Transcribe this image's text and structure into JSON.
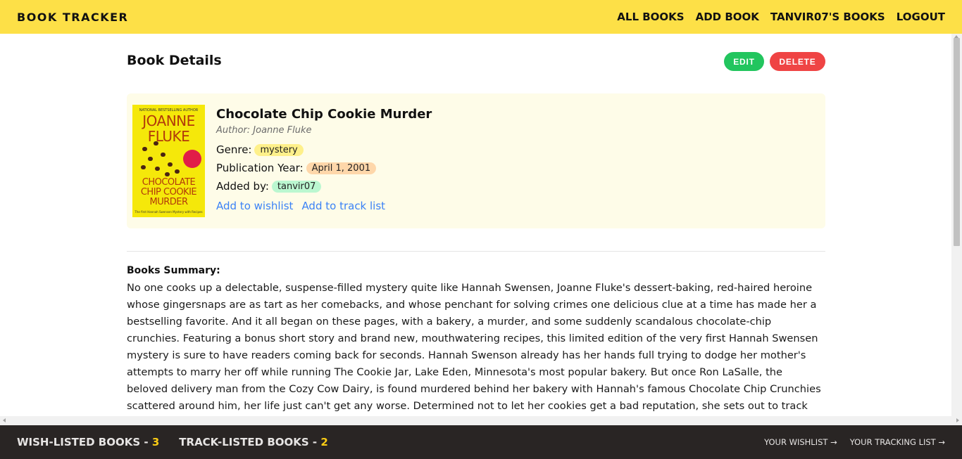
{
  "header": {
    "brand": "BOOK TRACKER",
    "nav": [
      "ALL BOOKS",
      "ADD BOOK",
      "TANVIR07'S BOOKS",
      "LOGOUT"
    ]
  },
  "page": {
    "title": "Book Details",
    "edit_label": "EDIT",
    "delete_label": "DELETE"
  },
  "book": {
    "title": "Chocolate Chip Cookie Murder",
    "author_line": "Author: Joanne Fluke",
    "genre_label": "Genre:",
    "genre": "mystery",
    "year_label": "Publication Year:",
    "year": "April 1, 2001",
    "added_label": "Added by:",
    "added_by": "tanvir07",
    "wishlist_link": "Add to wishlist",
    "tracklist_link": "Add to track list",
    "cover": {
      "top_text": "NATIONAL BESTSELLING AUTHOR",
      "author": "JOANNE FLUKE",
      "title": "CHOCOLATE CHIP COOKIE MURDER",
      "subtitle": "The first Hannah Swensen Mystery with Recipes"
    }
  },
  "summary": {
    "label": "Books Summary:",
    "text": "No one cooks up a delectable, suspense-filled mystery quite like Hannah Swensen, Joanne Fluke's dessert-baking, red-haired heroine whose gingersnaps are as tart as her comebacks, and whose penchant for solving crimes one delicious clue at a time has made her a bestselling favorite. And it all began on these pages, with a bakery, a murder, and some suddenly scandalous chocolate-chip crunchies. Featuring a bonus short story and brand new, mouthwatering recipes, this limited edition of the very first Hannah Swensen mystery is sure to have readers coming back for seconds. Hannah Swenson already has her hands full trying to dodge her mother's attempts to marry her off while running The Cookie Jar, Lake Eden, Minnesota's most popular bakery. But once Ron LaSalle, the beloved delivery man from the Cozy Cow Dairy, is found murdered behind her bakery with Hannah's famous Chocolate Chip Crunchies scattered around him, her life just can't get any worse. Determined not to let her cookies get a bad reputation, she sets out to track down a killer. Who would"
  },
  "footer": {
    "wish_label": "WISH-LISTED BOOKS - ",
    "wish_count": "3",
    "track_label": "TRACK-LISTED BOOKS - ",
    "track_count": "2",
    "your_wishlist": "YOUR WISHLIST →",
    "your_tracking": "YOUR TRACKING LIST →"
  },
  "colors": {
    "header_bg": "#fde047",
    "footer_bg": "#292524",
    "edit": "#22c55e",
    "delete": "#ef4444",
    "link": "#3b82f6",
    "count_accent": "#facc15"
  }
}
